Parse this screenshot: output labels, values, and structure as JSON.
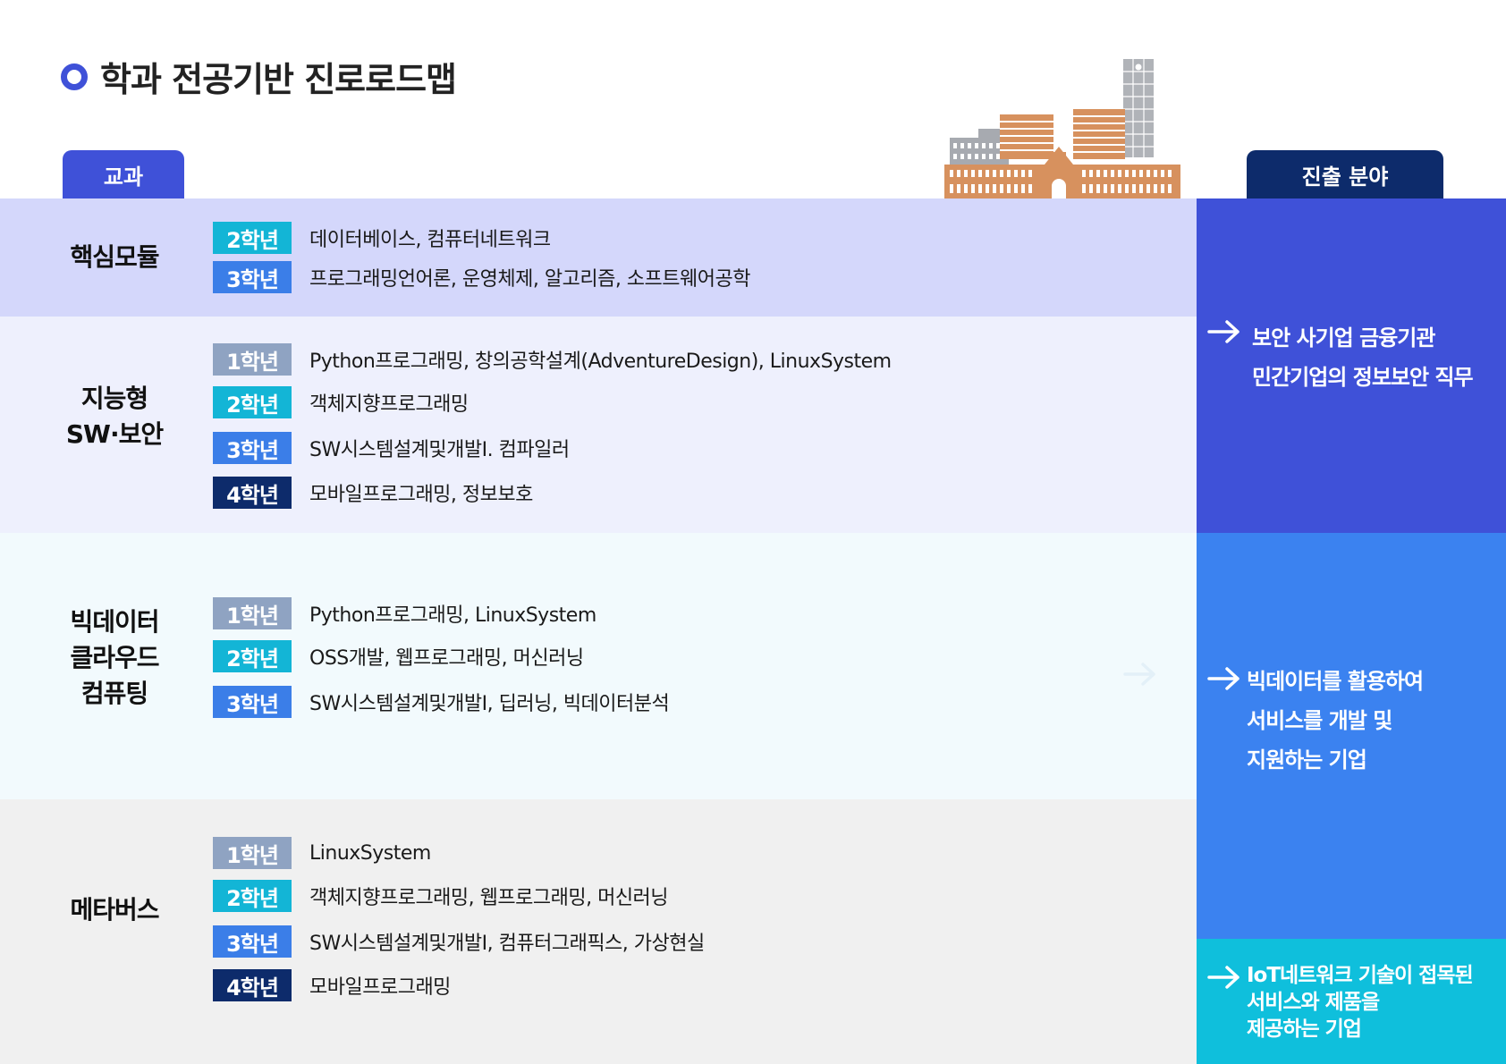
{
  "title": "학과 전공기반 진로로드맵",
  "tabs": {
    "subjects": "교과",
    "career": "진출 분야"
  },
  "groups": [
    {
      "name": "핵심모듈",
      "courses": [
        {
          "year": "2학년",
          "text": "데이터베이스, 컴퓨터네트워크"
        },
        {
          "year": "3학년",
          "text": "프로그래밍언어론, 운영체제, 알고리즘, 소프트웨어공학"
        }
      ]
    },
    {
      "name": "지능형\nSW·보안",
      "courses": [
        {
          "year": "1학년",
          "text": "Python프로그래밍, 창의공학설계(AdventureDesign), LinuxSystem"
        },
        {
          "year": "2학년",
          "text": "객체지향프로그래밍"
        },
        {
          "year": "3학년",
          "text": "SW시스템설계및개발I. 컴파일러"
        },
        {
          "year": "4학년",
          "text": "모바일프로그래밍, 정보보호"
        }
      ]
    },
    {
      "name": "빅데이터\n클라우드\n컴퓨팅",
      "courses": [
        {
          "year": "1학년",
          "text": "Python프로그래밍, LinuxSystem"
        },
        {
          "year": "2학년",
          "text": "OSS개발, 웹프로그래밍, 머신러닝"
        },
        {
          "year": "3학년",
          "text": "SW시스템설계및개발I, 딥러닝, 빅데이터분석"
        }
      ]
    },
    {
      "name": "메타버스",
      "courses": [
        {
          "year": "1학년",
          "text": "LinuxSystem"
        },
        {
          "year": "2학년",
          "text": "객체지향프로그래밍, 웹프로그래밍, 머신러닝"
        },
        {
          "year": "3학년",
          "text": "SW시스템설계및개발I, 컴퓨터그래픽스, 가상현실"
        },
        {
          "year": "4학년",
          "text": "모바일프로그래밍"
        }
      ]
    }
  ],
  "careers": [
    {
      "text": "보안 사기업 금융기관\n민간기업의 정보보안 직무",
      "icon": "arrow-right-icon"
    },
    {
      "text": "빅데이터를 활용하여\n서비스를 개발 및\n 지원하는 기업",
      "icon": "arrow-right-icon"
    },
    {
      "text": "IoT네트워크 기술이 접목된\n서비스와 제품을\n제공하는 기업",
      "icon": "arrow-right-icon"
    }
  ],
  "colors": {
    "primary": "#3f51d8",
    "navy": "#0d2b6b",
    "year1": "#8fa3c2",
    "year2": "#13b5d6",
    "year3": "#3b7ee8",
    "year4": "#0d2b6b",
    "career_blue": "#3b82f0",
    "career_cyan": "#0fbfdc"
  }
}
